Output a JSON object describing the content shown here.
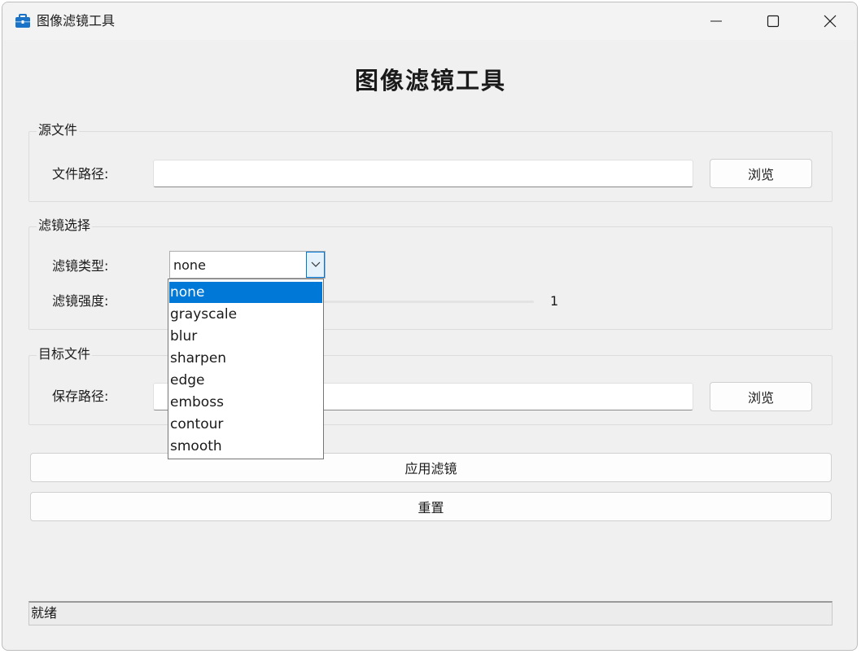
{
  "window": {
    "title": "图像滤镜工具",
    "minimize_symbol": "—",
    "close_symbol": "✕"
  },
  "heading": "图像滤镜工具",
  "source": {
    "group_title": "源文件",
    "path_label": "文件路径:",
    "path_value": "",
    "browse_label": "浏览"
  },
  "filter": {
    "group_title": "滤镜选择",
    "type_label": "滤镜类型:",
    "type_value": "none",
    "strength_label": "滤镜强度:",
    "strength_value": "1",
    "options": [
      "none",
      "grayscale",
      "blur",
      "sharpen",
      "edge",
      "emboss",
      "contour",
      "smooth"
    ],
    "selected_option": "none"
  },
  "target": {
    "group_title": "目标文件",
    "path_label": "保存路径:",
    "path_value": "",
    "browse_label": "浏览"
  },
  "actions": {
    "apply_label": "应用滤镜",
    "reset_label": "重置"
  },
  "status": {
    "text": "就绪"
  },
  "colors": {
    "accent": "#0078d7",
    "window_bg": "#f0f0f0",
    "app_icon": "#1a73c7"
  },
  "icons": {
    "app": "toolbox-icon",
    "minimize": "minimize-icon",
    "maximize": "maximize-icon",
    "close": "close-icon",
    "combo_arrow": "chevron-down-icon"
  }
}
